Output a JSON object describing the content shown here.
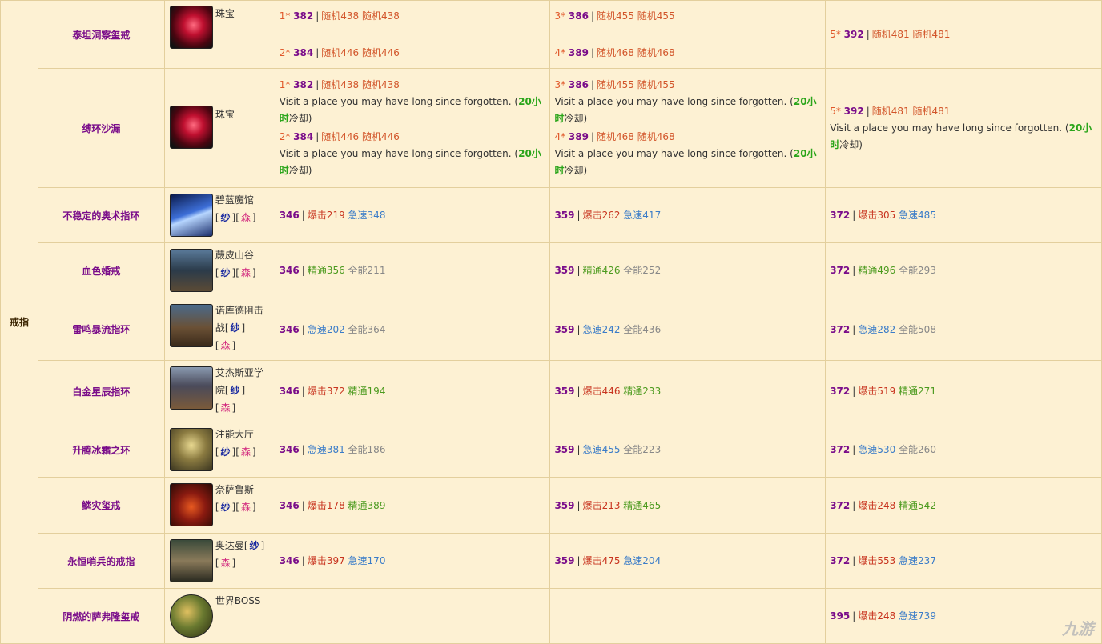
{
  "category": "戒指",
  "sep": "|",
  "sources": {
    "jewel": "珠宝",
    "azure": "碧蓝魔馆",
    "ruby": "蕨皮山谷",
    "nokhud": "诺库德阻击战",
    "algeth": "艾杰斯亚学院",
    "halls": "注能大厅",
    "neltharus": "奈萨鲁斯",
    "uldaman": "奥达曼",
    "boss": "世界BOSS"
  },
  "tags": {
    "a": "纱",
    "b": "森",
    "lb": "[",
    "rb": "]"
  },
  "random_label": "随机",
  "cd_text": "Visit a place you may have long since forgotten. (",
  "cd_time": "20小时",
  "cd_suffix": "冷却)",
  "rows": [
    {
      "name": "泰坦洞察玺戒"
    },
    {
      "name": "缚环沙漏"
    },
    {
      "name": "不稳定的奥术指环"
    },
    {
      "name": "血色婚戒"
    },
    {
      "name": "雷鸣暴流指环"
    },
    {
      "name": "白金星辰指环"
    },
    {
      "name": "升腾冰霜之环"
    },
    {
      "name": "鳞灾玺戒"
    },
    {
      "name": "永恒哨兵的戒指"
    },
    {
      "name": "阴燃的萨弗隆玺戒"
    }
  ],
  "upgrades": {
    "s1": {
      "star": "1*",
      "lv": "382",
      "r": "随机438"
    },
    "s2": {
      "star": "2*",
      "lv": "384",
      "r": "随机446"
    },
    "s3": {
      "star": "3*",
      "lv": "386",
      "r": "随机455"
    },
    "s4": {
      "star": "4*",
      "lv": "389",
      "r": "随机468"
    },
    "s5": {
      "star": "5*",
      "lv": "392",
      "r": "随机481"
    }
  },
  "stats": [
    {
      "c1": [
        "346",
        "爆击219",
        "急速348"
      ],
      "c2": [
        "359",
        "爆击262",
        "急速417"
      ],
      "c3": [
        "372",
        "爆击305",
        "急速485"
      ]
    },
    {
      "c1": [
        "346",
        "精通356",
        "全能211"
      ],
      "c2": [
        "359",
        "精通426",
        "全能252"
      ],
      "c3": [
        "372",
        "精通496",
        "全能293"
      ]
    },
    {
      "c1": [
        "346",
        "急速202",
        "全能364"
      ],
      "c2": [
        "359",
        "急速242",
        "全能436"
      ],
      "c3": [
        "372",
        "急速282",
        "全能508"
      ]
    },
    {
      "c1": [
        "346",
        "爆击372",
        "精通194"
      ],
      "c2": [
        "359",
        "爆击446",
        "精通233"
      ],
      "c3": [
        "372",
        "爆击519",
        "精通271"
      ]
    },
    {
      "c1": [
        "346",
        "急速381",
        "全能186"
      ],
      "c2": [
        "359",
        "急速455",
        "全能223"
      ],
      "c3": [
        "372",
        "急速530",
        "全能260"
      ]
    },
    {
      "c1": [
        "346",
        "爆击178",
        "精通389"
      ],
      "c2": [
        "359",
        "爆击213",
        "精通465"
      ],
      "c3": [
        "372",
        "爆击248",
        "精通542"
      ]
    },
    {
      "c1": [
        "346",
        "爆击397",
        "急速170"
      ],
      "c2": [
        "359",
        "爆击475",
        "急速204"
      ],
      "c3": [
        "372",
        "爆击553",
        "急速237"
      ]
    },
    {
      "c3": [
        "395",
        "爆击248",
        "急速739"
      ]
    }
  ],
  "watermark": "九游"
}
